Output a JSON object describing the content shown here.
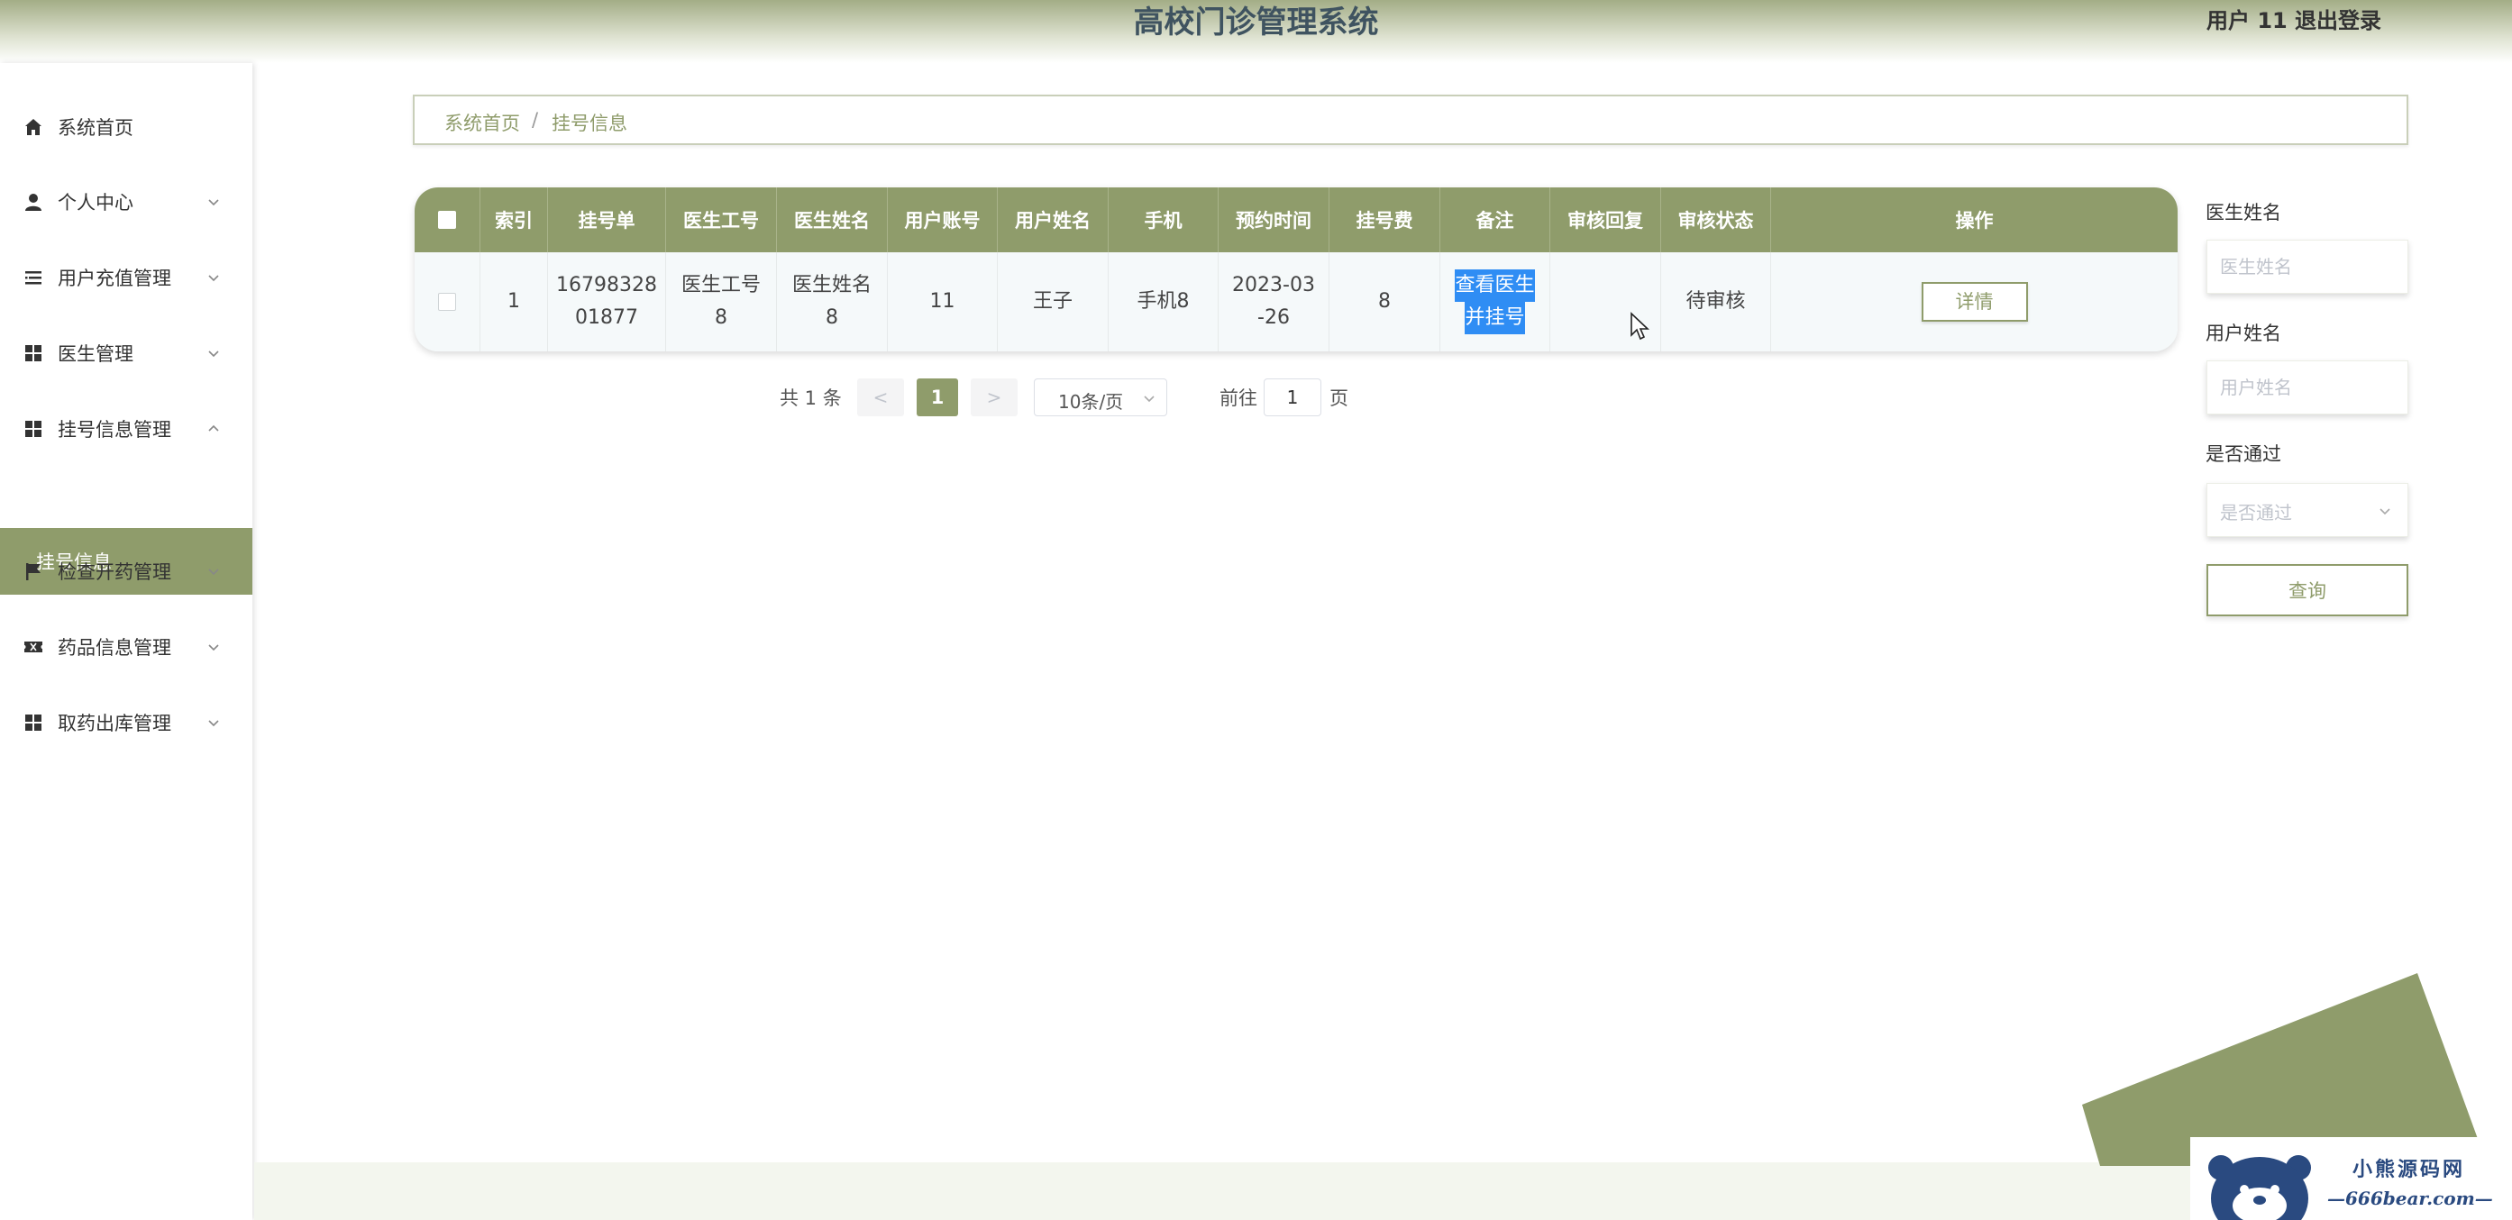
{
  "header": {
    "title": "高校门诊管理系统",
    "user": "用户 11",
    "logout": "退出登录"
  },
  "sidebar": {
    "items": [
      {
        "label": "系统首页",
        "icon": "home-icon"
      },
      {
        "label": "个人中心",
        "icon": "user-icon"
      },
      {
        "label": "用户充值管理",
        "icon": "list-icon"
      },
      {
        "label": "医生管理",
        "icon": "grid-icon"
      },
      {
        "label": "挂号信息管理",
        "icon": "grid-icon"
      },
      {
        "label": "检查开药管理",
        "icon": "flag-icon"
      },
      {
        "label": "药品信息管理",
        "icon": "ticket-icon"
      },
      {
        "label": "取药出库管理",
        "icon": "grid-icon"
      }
    ],
    "active_sub": "挂号信息"
  },
  "breadcrumb": {
    "home": "系统首页",
    "separator": "/",
    "current": "挂号信息"
  },
  "table": {
    "headers": [
      "索引",
      "挂号单",
      "医生工号",
      "医生姓名",
      "用户账号",
      "用户姓名",
      "手机",
      "预约时间",
      "挂号费",
      "备注",
      "审核回复",
      "审核状态",
      "操作"
    ],
    "row": {
      "index": "1",
      "order_line1": "16798328",
      "order_line2": "01877",
      "doctor_no_line1": "医生工号",
      "doctor_no_line2": "8",
      "doctor_name_line1": "医生姓名",
      "doctor_name_line2": "8",
      "account": "11",
      "user_name": "王子",
      "phone": "手机8",
      "time_line1": "2023-03",
      "time_line2": "-26",
      "fee": "8",
      "remark_line1": "查看医生",
      "remark_line2": "并挂号",
      "reply": "",
      "status": "待审核",
      "action": "详情"
    }
  },
  "pagination": {
    "total": "共 1 条",
    "prev": "<",
    "page": "1",
    "next": ">",
    "page_size": "10条/页",
    "goto": "前往",
    "goto_value": "1",
    "page_suffix": "页"
  },
  "search": {
    "doctor_label": "医生姓名",
    "doctor_placeholder": "医生姓名",
    "user_label": "用户姓名",
    "user_placeholder": "用户姓名",
    "pass_label": "是否通过",
    "pass_placeholder": "是否通过",
    "query": "查询"
  },
  "watermark": {
    "cn": "小熊源码网",
    "en": "—666bear.com—"
  },
  "colors": {
    "accent": "#8f9c6b",
    "selection": "#2f8df4",
    "title": "#3f5360"
  }
}
